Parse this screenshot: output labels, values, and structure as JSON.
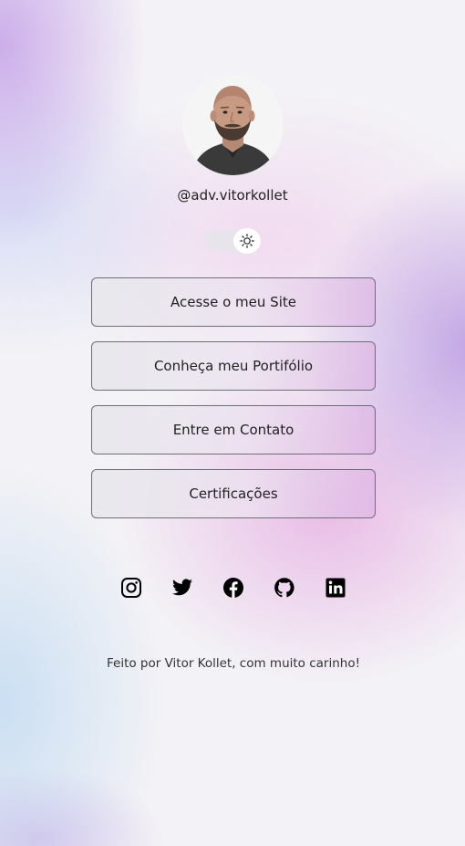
{
  "profile": {
    "handle": "@adv.vitorkollet",
    "avatar": "profile-photo"
  },
  "theme_toggle": {
    "icon": "sun-icon",
    "state": "light"
  },
  "links": [
    {
      "label": "Acesse o meu Site"
    },
    {
      "label": "Conheça meu Portifólio"
    },
    {
      "label": "Entre em Contato"
    },
    {
      "label": "Certificações"
    }
  ],
  "socials": [
    {
      "icon": "instagram-icon"
    },
    {
      "icon": "twitter-icon"
    },
    {
      "icon": "facebook-icon"
    },
    {
      "icon": "github-icon"
    },
    {
      "icon": "linkedin-icon"
    }
  ],
  "footer": {
    "text": "Feito por Vitor Kollet, com muito carinho!"
  }
}
